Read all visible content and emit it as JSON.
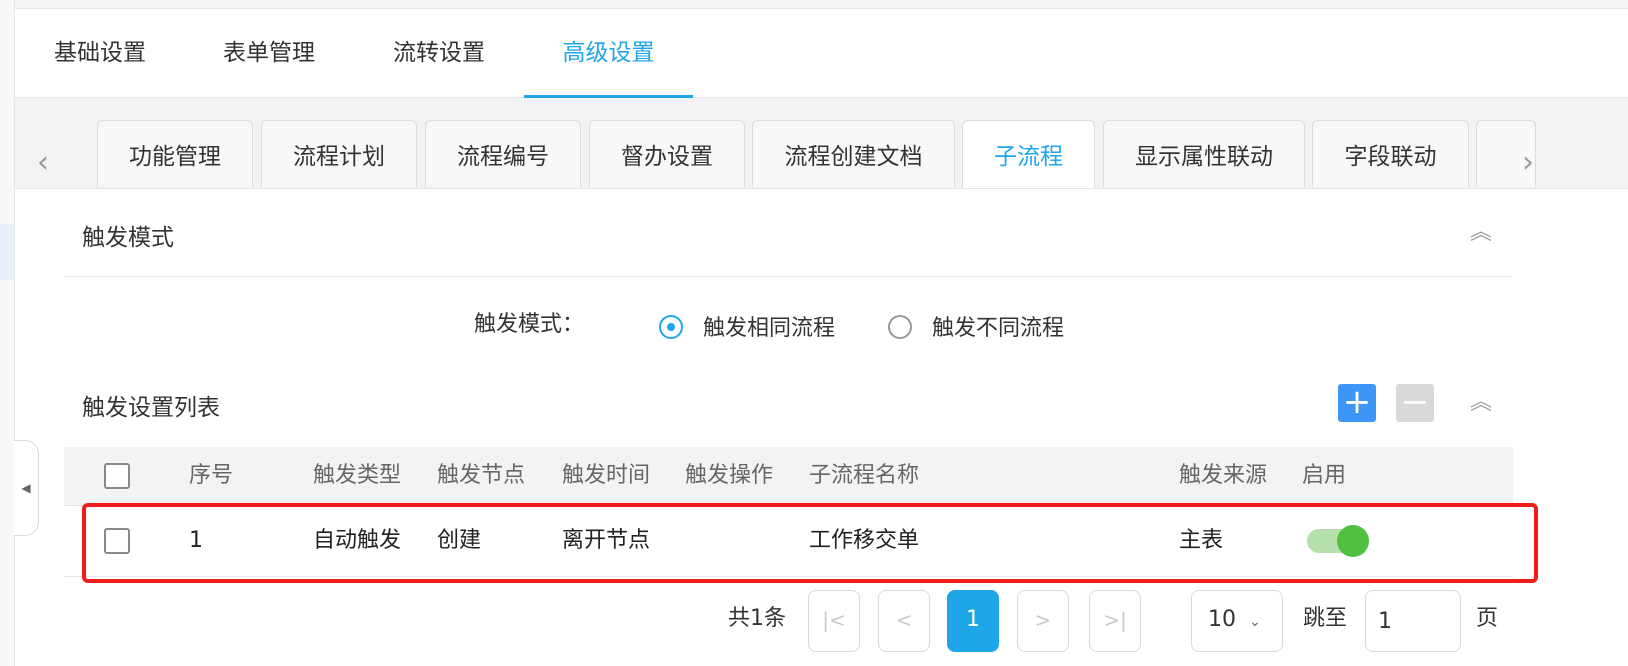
{
  "main_tabs": [
    "基础设置",
    "表单管理",
    "流转设置",
    "高级设置"
  ],
  "sub_tabs": [
    "功能管理",
    "流程计划",
    "流程编号",
    "督办设置",
    "流程创建文档",
    "子流程",
    "显示属性联动",
    "字段联动"
  ],
  "trigger_mode_section": {
    "title": "触发模式",
    "field_label": "触发模式：",
    "options": [
      "触发相同流程",
      "触发不同流程"
    ],
    "selected": "触发相同流程"
  },
  "trigger_list_section": {
    "title": "触发设置列表",
    "add_label": "+",
    "remove_label": "−"
  },
  "table": {
    "columns": [
      "序号",
      "触发类型",
      "触发节点",
      "触发时间",
      "触发操作",
      "子流程名称",
      "触发来源",
      "启用"
    ],
    "rows": [
      {
        "index": "1",
        "type": "自动触发",
        "node": "创建",
        "time": "离开节点",
        "operation": "",
        "subflow": "工作移交单",
        "source": "主表",
        "enabled": true
      }
    ]
  },
  "pagination": {
    "total_text": "共1条",
    "first": "|<",
    "prev": "<",
    "current": "1",
    "next": ">",
    "last": ">|",
    "page_size": "10",
    "jump_label": "跳至",
    "jump_value": "1",
    "page_unit": "页"
  },
  "icons": {
    "subtab_prev": "chevron-left-icon",
    "subtab_next": "chevron-right-icon",
    "collapse": "double-chevron-up-icon",
    "dropdown": "chevron-down-icon",
    "sidebar_toggle": "caret-left-icon"
  },
  "colors": {
    "accent": "#1ea6e8",
    "add_button": "#3d96f5",
    "toggle_on": "#4fbf40",
    "highlight": "#ef1c1c"
  }
}
